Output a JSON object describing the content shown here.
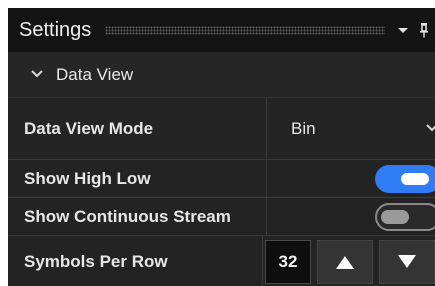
{
  "panel": {
    "title": "Settings",
    "icons": [
      "dropdown-arrow-icon",
      "pin-icon"
    ]
  },
  "section": {
    "label": "Data View",
    "icon": "chevron-down-icon",
    "expanded": true
  },
  "settings": {
    "data_view_mode": {
      "label": "Data View Mode",
      "value": "Bin"
    },
    "show_high_low": {
      "label": "Show High Low",
      "enabled": true
    },
    "show_continuous_stream": {
      "label": "Show Continuous Stream",
      "enabled": false
    },
    "symbols_per_row": {
      "label": "Symbols Per Row",
      "value": "32"
    }
  },
  "colors": {
    "toggle_on": "#2f7cf6",
    "panel_background": "#1e1e1e"
  }
}
